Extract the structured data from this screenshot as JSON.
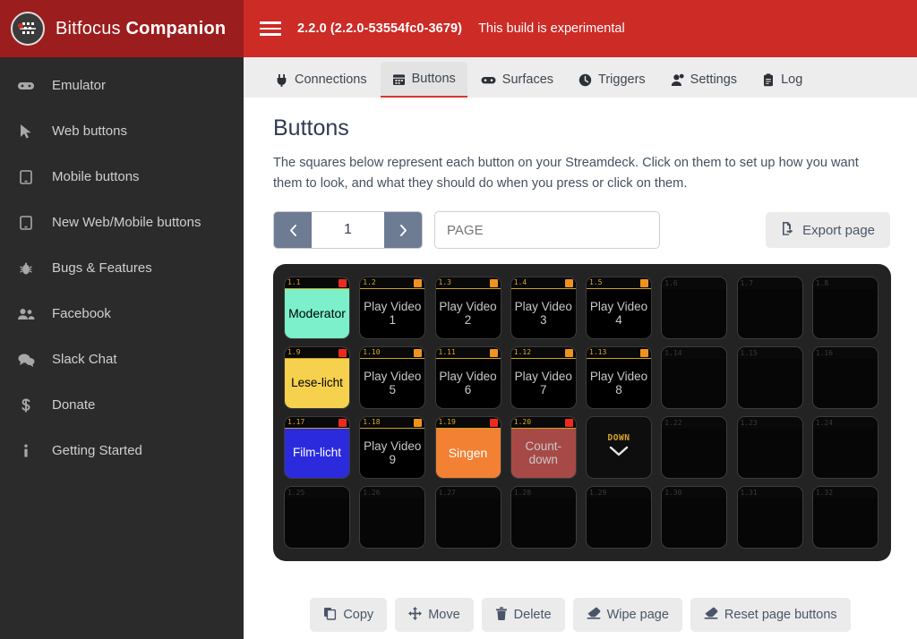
{
  "brand": {
    "name_light": "Bitfocus",
    "name_bold": "Companion",
    "logo_icon": "bitfocus-logo-icon"
  },
  "topbar": {
    "menu_icon": "hamburger-menu-icon",
    "version": "2.2.0 (2.2.0-53554fc0-3679)",
    "experimental_notice": "This build is experimental",
    "background_color": "#cc2b26"
  },
  "sidebar": {
    "background_color": "#2b2b2b",
    "items": [
      {
        "label": "Emulator",
        "icon": "gamepad-icon"
      },
      {
        "label": "Web buttons",
        "icon": "cursor-arrow-icon"
      },
      {
        "label": "Mobile buttons",
        "icon": "tablet-icon"
      },
      {
        "label": "New Web/Mobile buttons",
        "icon": "tablet-icon"
      },
      {
        "label": "Bugs & Features",
        "icon": "bug-icon"
      },
      {
        "label": "Facebook",
        "icon": "users-icon"
      },
      {
        "label": "Slack Chat",
        "icon": "comments-icon"
      },
      {
        "label": "Donate",
        "icon": "dollar-sign-icon"
      },
      {
        "label": "Getting Started",
        "icon": "info-icon"
      }
    ]
  },
  "tabs": [
    {
      "label": "Connections",
      "icon": "plug-icon",
      "active": false
    },
    {
      "label": "Buttons",
      "icon": "calendar-icon",
      "active": true
    },
    {
      "label": "Surfaces",
      "icon": "gamepad-icon",
      "active": false
    },
    {
      "label": "Triggers",
      "icon": "clock-icon",
      "active": false
    },
    {
      "label": "Settings",
      "icon": "user-gear-icon",
      "active": false
    },
    {
      "label": "Log",
      "icon": "clipboard-icon",
      "active": false
    }
  ],
  "page": {
    "title": "Buttons",
    "description": "The squares below represent each button on your Streamdeck. Click on them to set up how you want them to look, and what they should do when you press or click on them.",
    "prev_icon": "chevron-left-icon",
    "next_icon": "chevron-right-icon",
    "page_number": "1",
    "page_name_value": "",
    "page_name_placeholder": "PAGE",
    "export_label": "Export page",
    "export_icon": "file-export-icon",
    "active_tab_underline_color": "#d9372f"
  },
  "grid": {
    "columns": 8,
    "rows": 4,
    "buttons": [
      {
        "id": "1.1",
        "text": "Moderator",
        "bg": "#7bf0cb",
        "fg": "#000000",
        "indicator": "red",
        "filled": true
      },
      {
        "id": "1.2",
        "text": "Play Video 1",
        "bg": "#000000",
        "fg": "#c8c8c8",
        "indicator": "orange",
        "filled": true
      },
      {
        "id": "1.3",
        "text": "Play Video 2",
        "bg": "#000000",
        "fg": "#c8c8c8",
        "indicator": "orange",
        "filled": true
      },
      {
        "id": "1.4",
        "text": "Play Video 3",
        "bg": "#000000",
        "fg": "#c8c8c8",
        "indicator": "orange",
        "filled": true
      },
      {
        "id": "1.5",
        "text": "Play Video 4",
        "bg": "#000000",
        "fg": "#c8c8c8",
        "indicator": "orange",
        "filled": true
      },
      {
        "id": "1.6",
        "text": "",
        "bg": "#060606",
        "fg": "#3a3a3a",
        "indicator": "none",
        "filled": false
      },
      {
        "id": "1.7",
        "text": "",
        "bg": "#060606",
        "fg": "#3a3a3a",
        "indicator": "none",
        "filled": false
      },
      {
        "id": "1.8",
        "text": "",
        "bg": "#060606",
        "fg": "#3a3a3a",
        "indicator": "none",
        "filled": false
      },
      {
        "id": "1.9",
        "text": "Lese-licht",
        "bg": "#f5d14e",
        "fg": "#000000",
        "indicator": "red",
        "filled": true
      },
      {
        "id": "1.10",
        "text": "Play Video 5",
        "bg": "#000000",
        "fg": "#c8c8c8",
        "indicator": "orange",
        "filled": true
      },
      {
        "id": "1.11",
        "text": "Play Video 6",
        "bg": "#000000",
        "fg": "#c8c8c8",
        "indicator": "orange",
        "filled": true
      },
      {
        "id": "1.12",
        "text": "Play Video 7",
        "bg": "#000000",
        "fg": "#c8c8c8",
        "indicator": "orange",
        "filled": true
      },
      {
        "id": "1.13",
        "text": "Play Video 8",
        "bg": "#000000",
        "fg": "#c8c8c8",
        "indicator": "orange",
        "filled": true
      },
      {
        "id": "1.14",
        "text": "",
        "bg": "#060606",
        "fg": "#3a3a3a",
        "indicator": "none",
        "filled": false
      },
      {
        "id": "1.15",
        "text": "",
        "bg": "#060606",
        "fg": "#3a3a3a",
        "indicator": "none",
        "filled": false
      },
      {
        "id": "1.16",
        "text": "",
        "bg": "#060606",
        "fg": "#3a3a3a",
        "indicator": "none",
        "filled": false
      },
      {
        "id": "1.17",
        "text": "Film-licht",
        "bg": "#2b2bdd",
        "fg": "#ffffff",
        "indicator": "red",
        "filled": true
      },
      {
        "id": "1.18",
        "text": "Play Video 9",
        "bg": "#000000",
        "fg": "#c8c8c8",
        "indicator": "orange",
        "filled": true
      },
      {
        "id": "1.19",
        "text": "Singen",
        "bg": "#f28133",
        "fg": "#ffffff",
        "indicator": "red",
        "filled": true
      },
      {
        "id": "1.20",
        "text": "Count-down",
        "bg": "#a74a47",
        "fg": "#c9c9c9",
        "indicator": "red",
        "filled": true
      },
      {
        "id": "",
        "text": "DOWN",
        "bg": "#0e0e0e",
        "fg": "#d8a72a",
        "indicator": "none",
        "filled": false,
        "nav": true,
        "nav_icon": "chevron-down-icon"
      },
      {
        "id": "1.22",
        "text": "",
        "bg": "#060606",
        "fg": "#3a3a3a",
        "indicator": "none",
        "filled": false
      },
      {
        "id": "1.23",
        "text": "",
        "bg": "#060606",
        "fg": "#3a3a3a",
        "indicator": "none",
        "filled": false
      },
      {
        "id": "1.24",
        "text": "",
        "bg": "#060606",
        "fg": "#3a3a3a",
        "indicator": "none",
        "filled": false
      },
      {
        "id": "1.25",
        "text": "",
        "bg": "#060606",
        "fg": "#3a3a3a",
        "indicator": "none",
        "filled": false
      },
      {
        "id": "1.26",
        "text": "",
        "bg": "#060606",
        "fg": "#3a3a3a",
        "indicator": "none",
        "filled": false
      },
      {
        "id": "1.27",
        "text": "",
        "bg": "#060606",
        "fg": "#3a3a3a",
        "indicator": "none",
        "filled": false
      },
      {
        "id": "1.28",
        "text": "",
        "bg": "#060606",
        "fg": "#3a3a3a",
        "indicator": "none",
        "filled": false
      },
      {
        "id": "1.29",
        "text": "",
        "bg": "#060606",
        "fg": "#3a3a3a",
        "indicator": "none",
        "filled": false
      },
      {
        "id": "1.30",
        "text": "",
        "bg": "#060606",
        "fg": "#3a3a3a",
        "indicator": "none",
        "filled": false
      },
      {
        "id": "1.31",
        "text": "",
        "bg": "#060606",
        "fg": "#3a3a3a",
        "indicator": "none",
        "filled": false
      },
      {
        "id": "1.32",
        "text": "",
        "bg": "#060606",
        "fg": "#3a3a3a",
        "indicator": "none",
        "filled": false
      }
    ]
  },
  "actions": [
    {
      "label": "Copy",
      "icon": "copy-icon"
    },
    {
      "label": "Move",
      "icon": "arrows-move-icon"
    },
    {
      "label": "Delete",
      "icon": "trash-icon"
    },
    {
      "label": "Wipe page",
      "icon": "eraser-icon"
    },
    {
      "label": "Reset page buttons",
      "icon": "eraser-icon"
    }
  ]
}
